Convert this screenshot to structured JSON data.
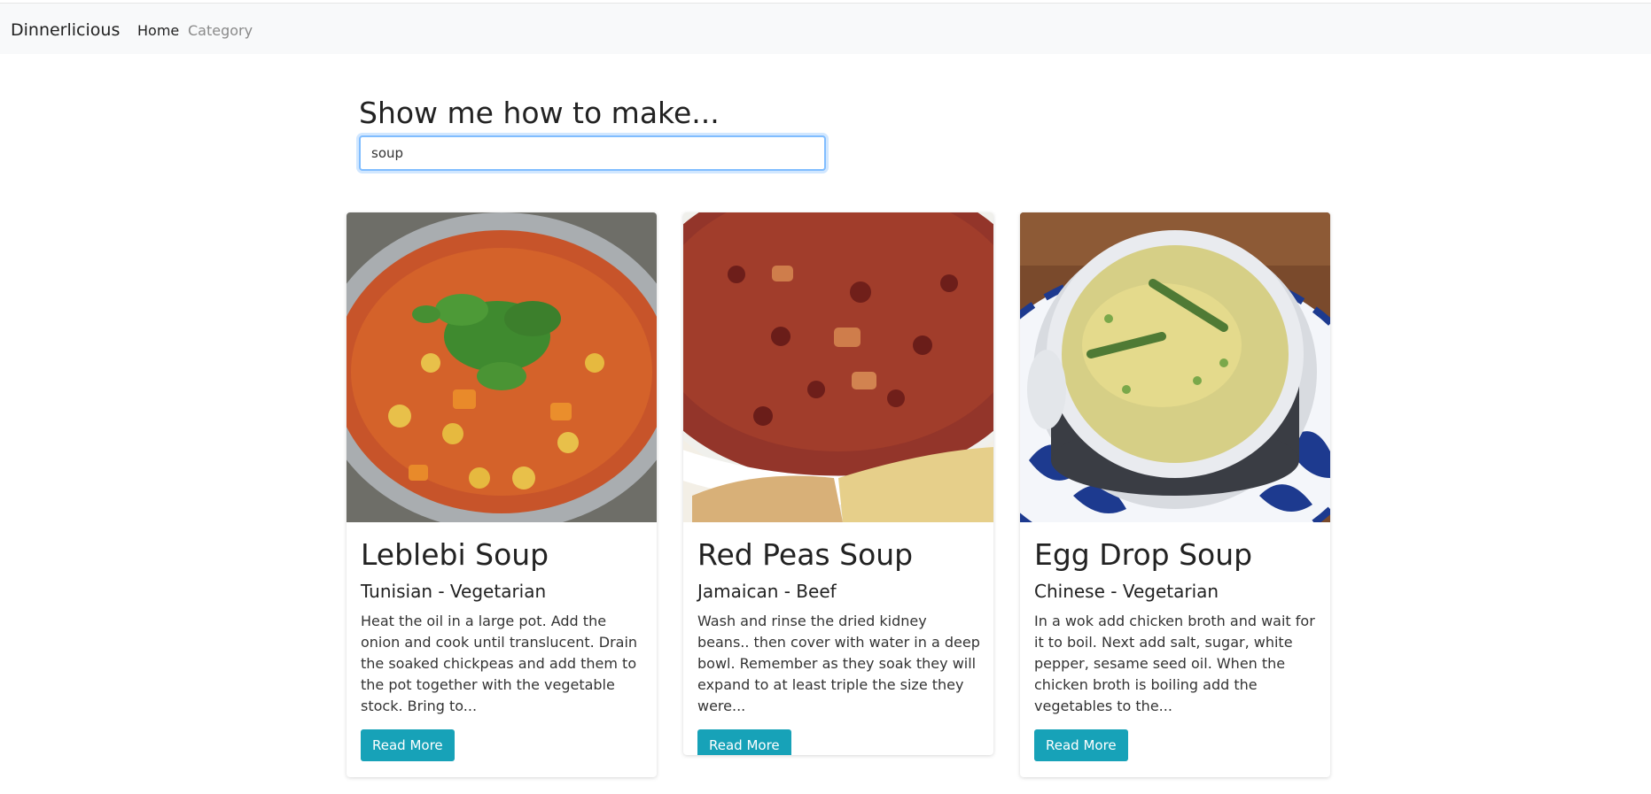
{
  "navbar": {
    "brand": "Dinnerlicious",
    "links": [
      "Home",
      "Category"
    ]
  },
  "search": {
    "heading": "Show me how to make...",
    "value": "soup"
  },
  "cards": [
    {
      "title": "Leblebi Soup",
      "subtitle": "Tunisian - Vegetarian",
      "text": "Heat the oil in a large pot. Add the onion and cook until translucent. Drain the soaked chickpeas and add them to the pot together with the vegetable stock. Bring to...",
      "button": "Read More"
    },
    {
      "title": "Red Peas Soup",
      "subtitle": "Jamaican - Beef",
      "text": "Wash and rinse the dried kidney beans.. then cover with water in a deep bowl. Remember as they soak they will expand to at least triple the size they were...",
      "button": "Read More"
    },
    {
      "title": "Egg Drop Soup",
      "subtitle": "Chinese - Vegetarian",
      "text": "In a wok add chicken broth and wait for it to boil. Next add salt, sugar, white pepper, sesame seed oil. When the chicken broth is boiling add the vegetables to the...",
      "button": "Read More"
    }
  ],
  "colors": {
    "button": "#17a2b8",
    "navbar": "#f8f9fa"
  }
}
